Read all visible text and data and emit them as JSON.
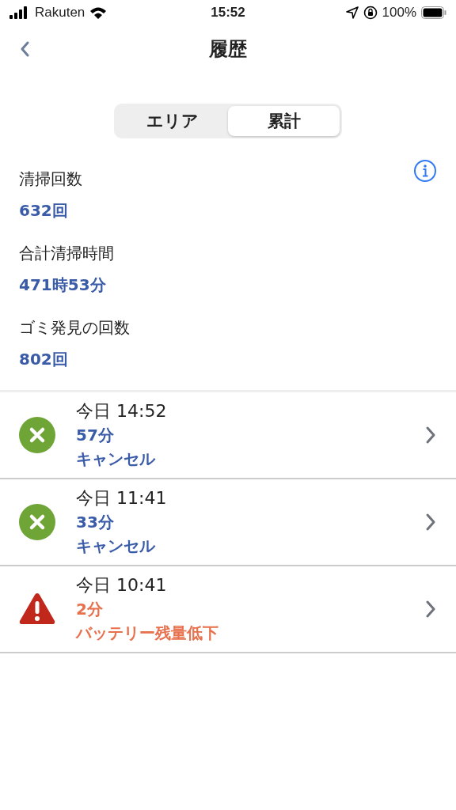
{
  "status_bar": {
    "carrier": "Rakuten",
    "time": "15:52",
    "battery": "100%"
  },
  "nav": {
    "title": "履歴"
  },
  "tabs": [
    {
      "label": "エリア",
      "selected": false
    },
    {
      "label": "累計",
      "selected": true
    }
  ],
  "stats": [
    {
      "label": "清掃回数",
      "value": "632回"
    },
    {
      "label": "合計清掃時間",
      "value": "471時53分"
    },
    {
      "label": "ゴミ発見の回数",
      "value": "802回"
    }
  ],
  "history": [
    {
      "kind": "cancelled",
      "time": "今日 14:52",
      "duration": "57分",
      "result": "キャンセル"
    },
    {
      "kind": "cancelled",
      "time": "今日 11:41",
      "duration": "33分",
      "result": "キャンセル"
    },
    {
      "kind": "warning",
      "time": "今日 10:41",
      "duration": "2分",
      "result": "バッテリー残量低下"
    }
  ]
}
